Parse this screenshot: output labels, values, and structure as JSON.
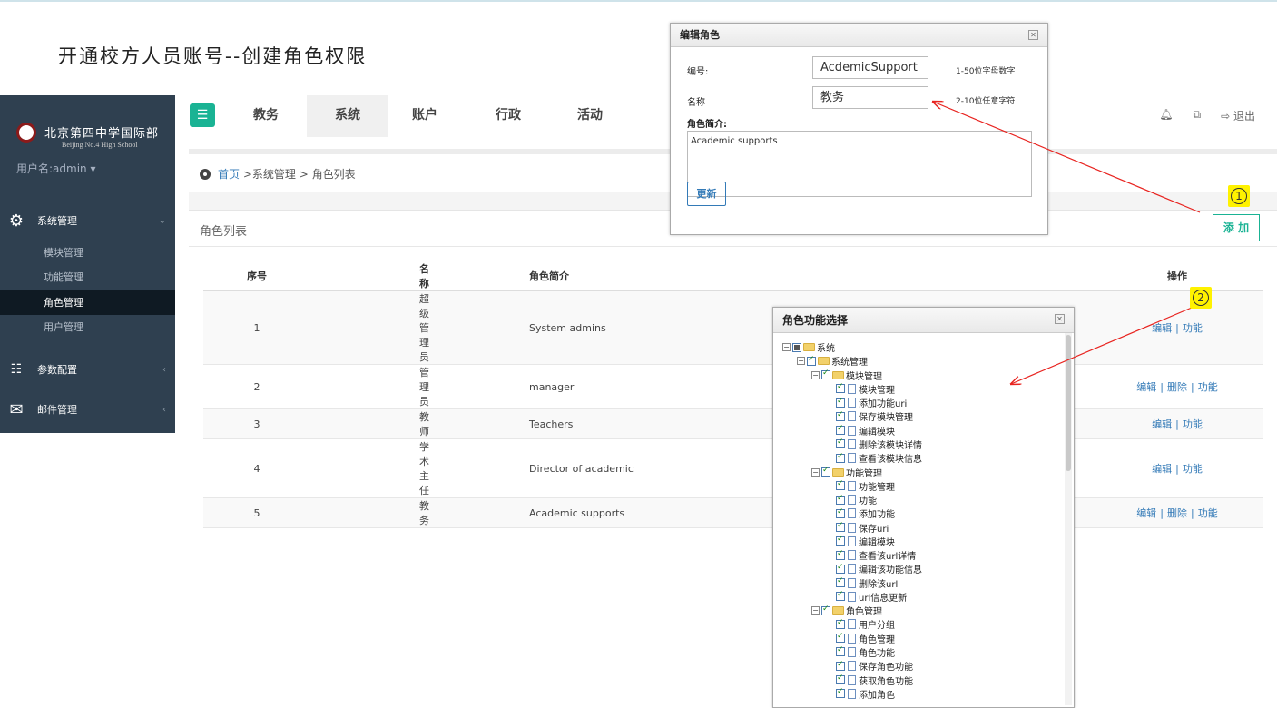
{
  "doc_title": "开通校方人员账号--创建角色权限",
  "sidebar": {
    "logo_name": "北京第四中学国际部",
    "logo_sub": "Beijing No.4 High School",
    "user": "用户名:admin",
    "menus": [
      {
        "label": "系统管理",
        "icon": "gears-icon",
        "items": [
          "模块管理",
          "功能管理",
          "角色管理",
          "用户管理"
        ],
        "active_item": "角色管理"
      },
      {
        "label": "参数配置",
        "icon": "sliders-icon"
      },
      {
        "label": "邮件管理",
        "icon": "envelope-icon"
      }
    ]
  },
  "topnav": {
    "tabs": [
      "教务",
      "系统",
      "账户",
      "行政",
      "活动"
    ],
    "active": "系统",
    "logout": "退出"
  },
  "breadcrumb": {
    "home": "首页",
    "rest": " >系统管理 > 角色列表"
  },
  "panel": {
    "title": "角色列表",
    "add_label": "添 加"
  },
  "table": {
    "headers": [
      "序号",
      "名称",
      "角色简介",
      "操作"
    ],
    "rows": [
      {
        "no": "1",
        "name": "超级管理员",
        "desc": "System admins",
        "ops": [
          "编辑",
          "功能"
        ]
      },
      {
        "no": "2",
        "name": "管理员",
        "desc": "manager",
        "ops": [
          "编辑",
          "删除",
          "功能"
        ]
      },
      {
        "no": "3",
        "name": "教师",
        "desc": "Teachers",
        "ops": [
          "编辑",
          "功能"
        ]
      },
      {
        "no": "4",
        "name": "学术主任",
        "desc": "Director of academic",
        "ops": [
          "编辑",
          "功能"
        ]
      },
      {
        "no": "5",
        "name": "教务",
        "desc": "Academic supports",
        "ops": [
          "编辑",
          "删除",
          "功能"
        ]
      }
    ]
  },
  "edit_dialog": {
    "title": "编辑角色",
    "code_label": "编号:",
    "code_value": "AcdemicSupport",
    "code_hint": "1-50位字母数字",
    "name_label": "名称",
    "name_value": "教务",
    "name_hint": "2-10位任意字符",
    "intro_label": "角色简介:",
    "intro_value": "Academic supports",
    "update_label": "更新"
  },
  "func_dialog": {
    "title": "角色功能选择",
    "tree": [
      {
        "level": 0,
        "label": "系统",
        "type": "folder",
        "state": "part"
      },
      {
        "level": 1,
        "label": "系统管理",
        "type": "folder",
        "state": "on"
      },
      {
        "level": 2,
        "label": "模块管理",
        "type": "folder",
        "state": "on"
      },
      {
        "level": 3,
        "label": "模块管理",
        "type": "leaf",
        "state": "on"
      },
      {
        "level": 3,
        "label": "添加功能uri",
        "type": "leaf",
        "state": "on"
      },
      {
        "level": 3,
        "label": "保存模块管理",
        "type": "leaf",
        "state": "on"
      },
      {
        "level": 3,
        "label": "编辑模块",
        "type": "leaf",
        "state": "on"
      },
      {
        "level": 3,
        "label": "删除该模块详情",
        "type": "leaf",
        "state": "on"
      },
      {
        "level": 3,
        "label": "查看该模块信息",
        "type": "leaf",
        "state": "on"
      },
      {
        "level": 2,
        "label": "功能管理",
        "type": "folder",
        "state": "on"
      },
      {
        "level": 3,
        "label": "功能管理",
        "type": "leaf",
        "state": "on"
      },
      {
        "level": 3,
        "label": "功能",
        "type": "leaf",
        "state": "on"
      },
      {
        "level": 3,
        "label": "添加功能",
        "type": "leaf",
        "state": "on"
      },
      {
        "level": 3,
        "label": "保存uri",
        "type": "leaf",
        "state": "on"
      },
      {
        "level": 3,
        "label": "编辑模块",
        "type": "leaf",
        "state": "on"
      },
      {
        "level": 3,
        "label": "查看该url详情",
        "type": "leaf",
        "state": "on"
      },
      {
        "level": 3,
        "label": "编辑该功能信息",
        "type": "leaf",
        "state": "on"
      },
      {
        "level": 3,
        "label": "删除该url",
        "type": "leaf",
        "state": "on"
      },
      {
        "level": 3,
        "label": "url信息更新",
        "type": "leaf",
        "state": "on"
      },
      {
        "level": 2,
        "label": "角色管理",
        "type": "folder",
        "state": "on"
      },
      {
        "level": 3,
        "label": "用户分组",
        "type": "leaf",
        "state": "on"
      },
      {
        "level": 3,
        "label": "角色管理",
        "type": "leaf",
        "state": "on"
      },
      {
        "level": 3,
        "label": "角色功能",
        "type": "leaf",
        "state": "on"
      },
      {
        "level": 3,
        "label": "保存角色功能",
        "type": "leaf",
        "state": "on"
      },
      {
        "level": 3,
        "label": "获取角色功能",
        "type": "leaf",
        "state": "on"
      },
      {
        "level": 3,
        "label": "添加角色",
        "type": "leaf",
        "state": "on"
      }
    ]
  },
  "annotations": {
    "marker1": "1",
    "marker2": "2",
    "arrow_color": "#e8231f",
    "marker_color": "#fff200"
  },
  "colors": {
    "accent": "#1ab394",
    "sidebar": "#2f4050",
    "link": "#337ab7"
  }
}
